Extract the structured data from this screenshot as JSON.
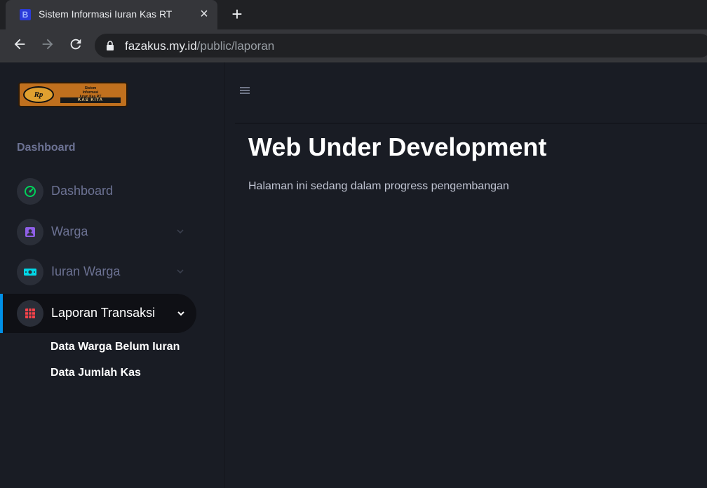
{
  "browser": {
    "tab_title": "Sistem Informasi Iuran Kas RT",
    "favicon_letter": "B",
    "url_host": "fazakus.my.id",
    "url_path": "/public/laporan"
  },
  "logo": {
    "badge": "Rp",
    "line1": "Sistem",
    "line2": "Informasi",
    "line3": "Iuran Kas RT",
    "bottom": "KAS KITA"
  },
  "sidebar": {
    "section_label": "Dashboard",
    "items": [
      {
        "label": "Dashboard",
        "icon": "speedometer-icon",
        "color": "#00d25b"
      },
      {
        "label": "Warga",
        "icon": "contact-card-icon",
        "color": "#8f5fe8"
      },
      {
        "label": "Iuran Warga",
        "icon": "cash-icon",
        "color": "#00d8e8"
      },
      {
        "label": "Laporan Transaksi",
        "icon": "table-icon",
        "color": "#fc424a"
      }
    ],
    "sub_items": [
      "Data Warga Belum Iuran",
      "Data Jumlah Kas"
    ]
  },
  "main": {
    "title": "Web Under Development",
    "description": "Halaman ini sedang dalam progress pengembangan"
  },
  "colors": {
    "accent": "#0090e7",
    "background": "#191c24",
    "muted_text": "#6c7293"
  }
}
